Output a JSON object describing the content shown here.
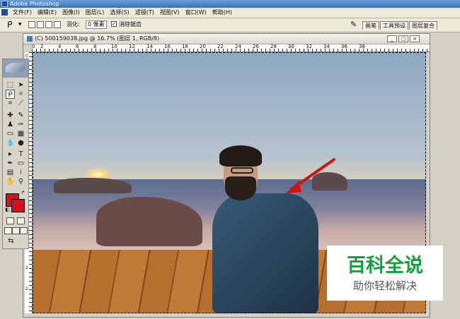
{
  "app": {
    "window_title": "Adobe Photoshop"
  },
  "menu": {
    "items": [
      "文件(F)",
      "编辑(E)",
      "图像(I)",
      "图层(L)",
      "选择(S)",
      "滤镜(T)",
      "视图(V)",
      "窗口(W)",
      "帮助(H)"
    ]
  },
  "options": {
    "feather_label": "羽化:",
    "feather_value": "0 像素",
    "antialias_label": "消除锯齿",
    "antialias_checked": true
  },
  "palette_tabs": [
    "画笔",
    "工具预设",
    "图层复合"
  ],
  "document": {
    "title": "(C) 500159038.jpg @ 16.7% (图层 1, RGB/8)",
    "ruler_top": [
      "0",
      "2",
      "4",
      "6",
      "8",
      "10",
      "12",
      "14",
      "16",
      "18",
      "20",
      "22",
      "24",
      "26",
      "28",
      "30",
      "32",
      "34",
      "36",
      "38"
    ],
    "ruler_left": [
      "0",
      "2",
      "4",
      "6",
      "8",
      "1",
      "1",
      "1",
      "1",
      "2",
      "2",
      "2"
    ]
  },
  "colors": {
    "foreground": "#d8101e",
    "background": "#d8101e",
    "annotation_arrow": "#d11212",
    "watermark_green": "#14a03c"
  },
  "watermark": {
    "main": "百科全说",
    "sub": "助你轻松解决"
  }
}
